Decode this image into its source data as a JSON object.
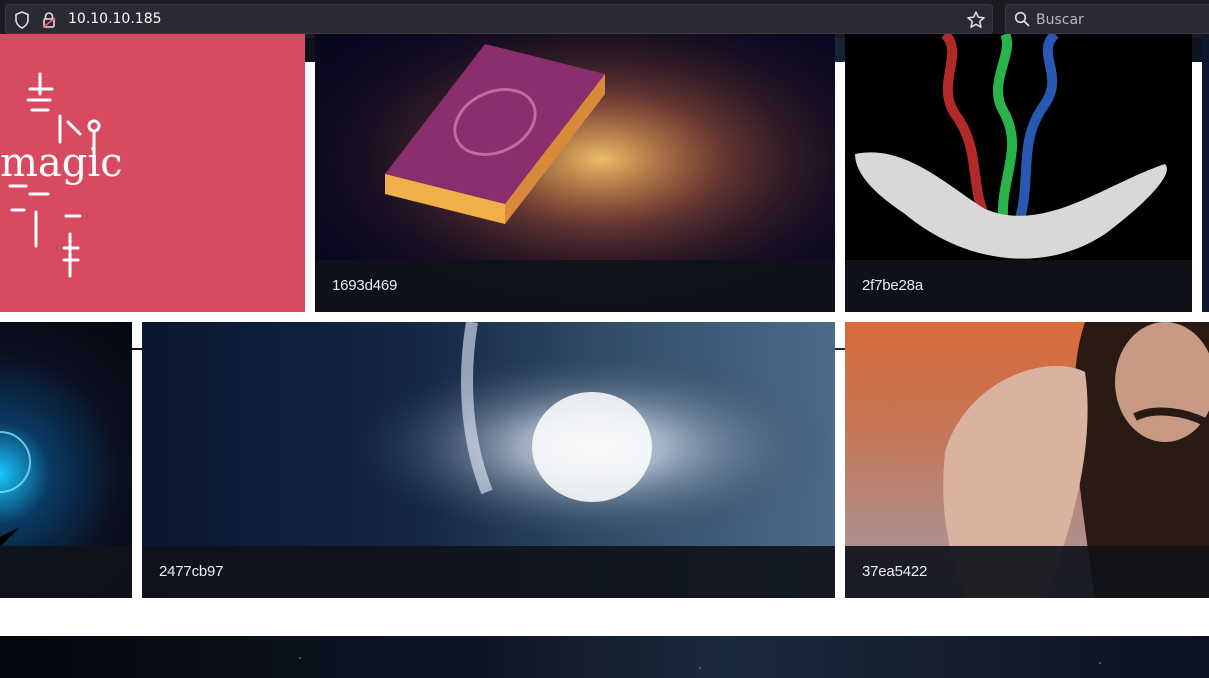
{
  "browser": {
    "url": "10.10.10.185",
    "search_placeholder": "Buscar"
  },
  "gallery": {
    "row1": [
      {
        "caption": ""
      },
      {
        "caption": "1693d469"
      },
      {
        "caption": "2f7be28a"
      }
    ],
    "row2": [
      {
        "caption": ""
      },
      {
        "caption": "2477cb97"
      },
      {
        "caption": "37ea5422"
      }
    ],
    "magic_logo_text": "magic"
  },
  "colors": {
    "magic_tile": "#d84a62",
    "caption_bg": "#0f121a",
    "toolbar_bg": "#1c1b22"
  }
}
